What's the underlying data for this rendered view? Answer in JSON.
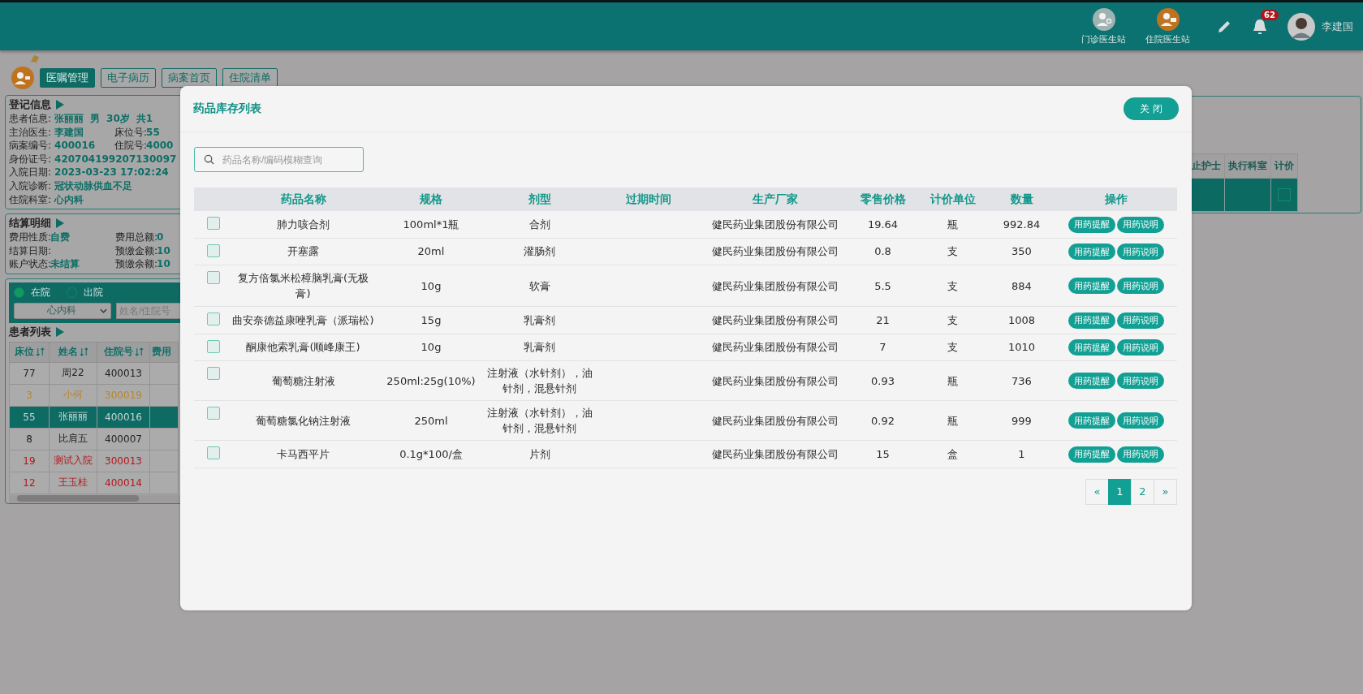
{
  "top_bar": {
    "stations": [
      {
        "label": "门诊医生站",
        "kind": "outpatient"
      },
      {
        "label": "住院医生站",
        "kind": "inpatient"
      }
    ],
    "notification_count": "62",
    "user_name": "李建国"
  },
  "tabs": [
    {
      "label": "医嘱管理",
      "selected": true
    },
    {
      "label": "电子病历",
      "selected": false
    },
    {
      "label": "病案首页",
      "selected": false
    },
    {
      "label": "住院清单",
      "selected": false
    }
  ],
  "registration": {
    "title": "登记信息",
    "lines": [
      {
        "left": [
          {
            "kind": "label",
            "text": "患者信息:"
          },
          {
            "kind": "value",
            "text": "张丽丽"
          },
          {
            "kind": "value",
            "text": "男"
          },
          {
            "kind": "value",
            "text": "30岁"
          },
          {
            "kind": "value",
            "text": "共1"
          }
        ]
      },
      {
        "left": [
          {
            "kind": "label",
            "text": "主治医生:"
          },
          {
            "kind": "value",
            "text": "李建国"
          }
        ],
        "right": [
          {
            "kind": "label",
            "text": "床位号:"
          },
          {
            "kind": "value",
            "text": "55"
          }
        ]
      },
      {
        "left": [
          {
            "kind": "label",
            "text": "病案编号:"
          },
          {
            "kind": "value",
            "text": "400016"
          }
        ],
        "right": [
          {
            "kind": "label",
            "text": "住院号:"
          },
          {
            "kind": "value",
            "text": "4000"
          }
        ]
      },
      {
        "left": [
          {
            "kind": "label",
            "text": "身份证号:"
          },
          {
            "kind": "value",
            "text": "420704199207130097"
          }
        ]
      },
      {
        "left": [
          {
            "kind": "label",
            "text": "入院日期:"
          },
          {
            "kind": "value",
            "text": "2023-03-23 17:02:24"
          }
        ]
      },
      {
        "left": [
          {
            "kind": "label",
            "text": "入院诊断:"
          },
          {
            "kind": "value",
            "text": "冠状动脉供血不足"
          }
        ]
      },
      {
        "left": [
          {
            "kind": "label",
            "text": "住院科室:"
          },
          {
            "kind": "value",
            "text": "心内科"
          }
        ]
      }
    ]
  },
  "settlement": {
    "title": "结算明细",
    "lines": [
      {
        "left": [
          {
            "kind": "label",
            "text": "费用性质:"
          },
          {
            "kind": "value",
            "text": "自费"
          }
        ],
        "right": [
          {
            "kind": "label",
            "text": "费用总额:"
          },
          {
            "kind": "value",
            "text": "0"
          }
        ]
      },
      {
        "left": [
          {
            "kind": "label",
            "text": "结算日期:"
          }
        ],
        "right": [
          {
            "kind": "label",
            "text": "预缴金额:"
          },
          {
            "kind": "value",
            "text": "10"
          }
        ]
      },
      {
        "left": [
          {
            "kind": "label",
            "text": "账户状态:"
          },
          {
            "kind": "value",
            "text": "未结算"
          }
        ],
        "right": [
          {
            "kind": "label",
            "text": "预缴余额:"
          },
          {
            "kind": "value",
            "text": "10"
          }
        ]
      }
    ]
  },
  "patient_filter": {
    "status_options": [
      {
        "label": "在院",
        "selected": true
      },
      {
        "label": "出院",
        "selected": false
      }
    ],
    "department": "心内科",
    "search_placeholder": "姓名/住院号"
  },
  "patient_list": {
    "title": "患者列表",
    "columns": [
      {
        "label": "床位",
        "sortable": true
      },
      {
        "label": "姓名",
        "sortable": true
      },
      {
        "label": "住院号",
        "sortable": true
      },
      {
        "label": "费用",
        "sortable": false
      }
    ],
    "rows": [
      {
        "bed": "77",
        "name": "周22",
        "admission_no": "400013",
        "selected": false,
        "kind": "normal"
      },
      {
        "bed": "3",
        "name": "小何",
        "admission_no": "300019",
        "selected": false,
        "kind": "pending"
      },
      {
        "bed": "55",
        "name": "张丽丽",
        "admission_no": "400016",
        "selected": true
      },
      {
        "bed": "8",
        "name": "比肩五",
        "admission_no": "400007",
        "selected": false,
        "kind": "normal"
      },
      {
        "bed": "19",
        "name": "测试入院",
        "admission_no": "300013",
        "selected": false,
        "kind": "alert"
      },
      {
        "bed": "12",
        "name": "王玉桂",
        "admission_no": "400014",
        "selected": false,
        "kind": "alert"
      }
    ]
  },
  "orders_table": {
    "columns": [
      "止护士",
      "执行科室",
      "计价"
    ],
    "rows": [
      {
        "selected": true,
        "priced": false
      }
    ]
  },
  "modal": {
    "title": "药品库存列表",
    "close_label": "关 闭",
    "search_placeholder": "药品名称/编码模糊查询",
    "columns": [
      "药品名称",
      "规格",
      "剂型",
      "过期时间",
      "生产厂家",
      "零售价格",
      "计价单位",
      "数量",
      "操作"
    ],
    "rows": [
      {
        "checked": false,
        "name": "肺力咳合剂",
        "spec": "100ml*1瓶",
        "form": "合剂",
        "manufacturer": "健民药业集团股份有限公司",
        "price": "19.64",
        "unit": "瓶",
        "quantity": "992.84",
        "actions": [
          "用药提醒",
          "用药说明"
        ]
      },
      {
        "checked": false,
        "name": "开塞露",
        "spec": "20ml",
        "form": "灌肠剂",
        "manufacturer": "健民药业集团股份有限公司",
        "price": "0.8",
        "unit": "支",
        "quantity": "350",
        "actions": [
          "用药提醒",
          "用药说明"
        ]
      },
      {
        "checked": false,
        "name": "复方倍氯米松樟脑乳膏(无极膏)",
        "spec": "10g",
        "form": "软膏",
        "manufacturer": "健民药业集团股份有限公司",
        "price": "5.5",
        "unit": "支",
        "quantity": "884",
        "actions": [
          "用药提醒",
          "用药说明"
        ]
      },
      {
        "checked": false,
        "name": "曲安奈德益康唑乳膏（派瑞松)",
        "spec": "15g",
        "form": "乳膏剂",
        "manufacturer": "健民药业集团股份有限公司",
        "price": "21",
        "unit": "支",
        "quantity": "1008",
        "actions": [
          "用药提醒",
          "用药说明"
        ]
      },
      {
        "checked": false,
        "name": "酮康他索乳膏(顺峰康王)",
        "spec": "10g",
        "form": "乳膏剂",
        "manufacturer": "健民药业集团股份有限公司",
        "price": "7",
        "unit": "支",
        "quantity": "1010",
        "actions": [
          "用药提醒",
          "用药说明"
        ]
      },
      {
        "checked": false,
        "name": "葡萄糖注射液",
        "spec": "250ml:25g(10%)",
        "form": "注射液（水针剂），油针剂，混悬针剂",
        "manufacturer": "健民药业集团股份有限公司",
        "price": "0.93",
        "unit": "瓶",
        "quantity": "736",
        "actions": [
          "用药提醒",
          "用药说明"
        ]
      },
      {
        "checked": false,
        "name": "葡萄糖氯化钠注射液",
        "spec": "250ml",
        "form": "注射液（水针剂），油针剂，混悬针剂",
        "manufacturer": "健民药业集团股份有限公司",
        "price": "0.92",
        "unit": "瓶",
        "quantity": "999",
        "actions": [
          "用药提醒",
          "用药说明"
        ]
      },
      {
        "checked": false,
        "name": "卡马西平片",
        "spec": "0.1g*100/盒",
        "form": "片剂",
        "manufacturer": "健民药业集团股份有限公司",
        "price": "15",
        "unit": "盒",
        "quantity": "1",
        "actions": [
          "用药提醒",
          "用药说明"
        ]
      }
    ],
    "pagination": [
      {
        "label": "«",
        "selected": false
      },
      {
        "label": "1",
        "selected": true
      },
      {
        "label": "2",
        "selected": false
      },
      {
        "label": "»",
        "selected": false
      }
    ]
  }
}
